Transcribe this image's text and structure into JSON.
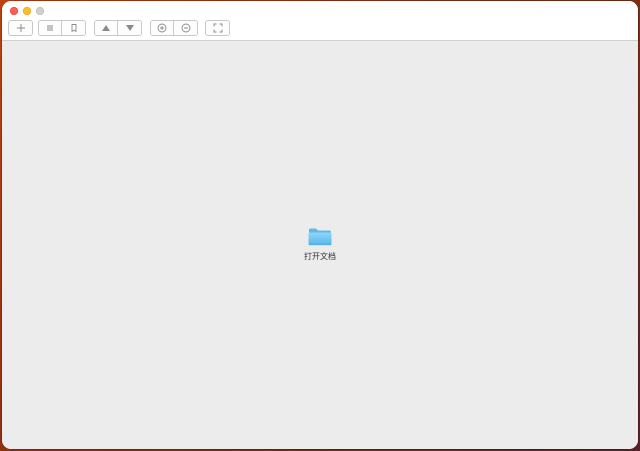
{
  "window": {
    "background": "#ececec",
    "titlebar_background": "#ffffff"
  },
  "traffic_lights": {
    "close_color": "#ff5f57",
    "minimize_color": "#febc2e",
    "zoom_color": "#d0d0d0"
  },
  "toolbar": {
    "groups": [
      {
        "buttons": [
          {
            "icon": "plus-icon"
          }
        ]
      },
      {
        "buttons": [
          {
            "icon": "list-icon"
          },
          {
            "icon": "bookmark-icon"
          }
        ]
      },
      {
        "buttons": [
          {
            "icon": "triangle-up-icon"
          },
          {
            "icon": "triangle-down-icon"
          }
        ]
      },
      {
        "buttons": [
          {
            "icon": "zoom-in-icon"
          },
          {
            "icon": "zoom-out-icon"
          }
        ]
      },
      {
        "buttons": [
          {
            "icon": "fullscreen-icon"
          }
        ]
      }
    ],
    "icon_color": "#8a8a8a"
  },
  "main": {
    "open_document": {
      "icon": "folder-icon",
      "label": "打开文档",
      "folder_color": "#6cc4f0"
    }
  }
}
